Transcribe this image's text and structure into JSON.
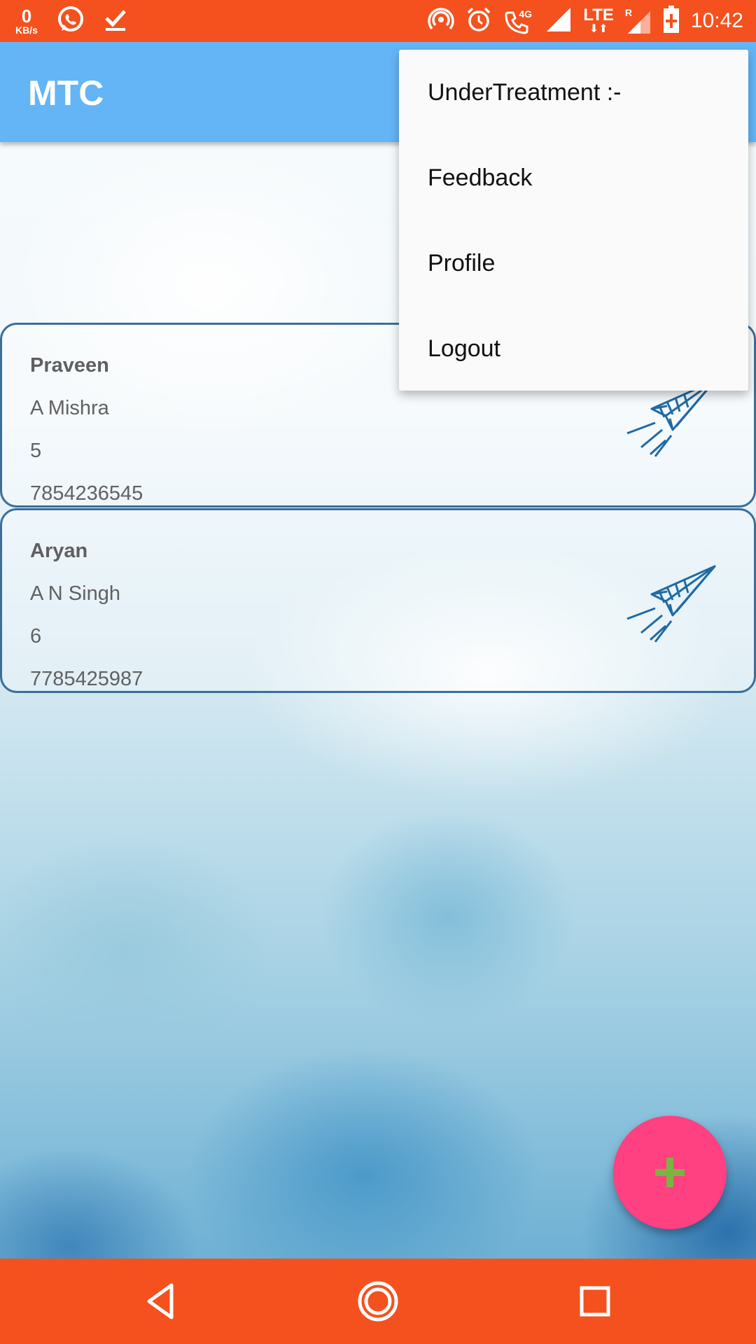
{
  "status_bar": {
    "speed_value": "0",
    "speed_unit": "KB/s",
    "network_label": "4G",
    "lte_label": "LTE",
    "roaming_label": "R",
    "time": "10:42",
    "icons": [
      "whatsapp-icon",
      "download-done-icon",
      "hotspot-icon",
      "alarm-icon",
      "volte-call-icon",
      "signal-icon",
      "battery-charging-icon"
    ]
  },
  "app_bar": {
    "title": "MTC",
    "color": "#64b5f6"
  },
  "overflow_menu": {
    "items": [
      {
        "label": "UnderTreatment :-"
      },
      {
        "label": "Feedback"
      },
      {
        "label": "Profile"
      },
      {
        "label": "Logout"
      }
    ]
  },
  "patients": [
    {
      "name": "Praveen",
      "parent": "A Mishra",
      "age": "5",
      "phone": "7854236545",
      "icon": "paper-plane-icon"
    },
    {
      "name": "Aryan",
      "parent": "A N Singh",
      "age": "6",
      "phone": "7785425987",
      "icon": "paper-plane-icon"
    }
  ],
  "fab": {
    "icon": "plus-icon",
    "color": "#ff4081",
    "icon_color": "#7cb342"
  },
  "nav_bar": {
    "icons": [
      "back-icon",
      "home-icon",
      "recents-icon"
    ],
    "color": "#f4511e"
  }
}
